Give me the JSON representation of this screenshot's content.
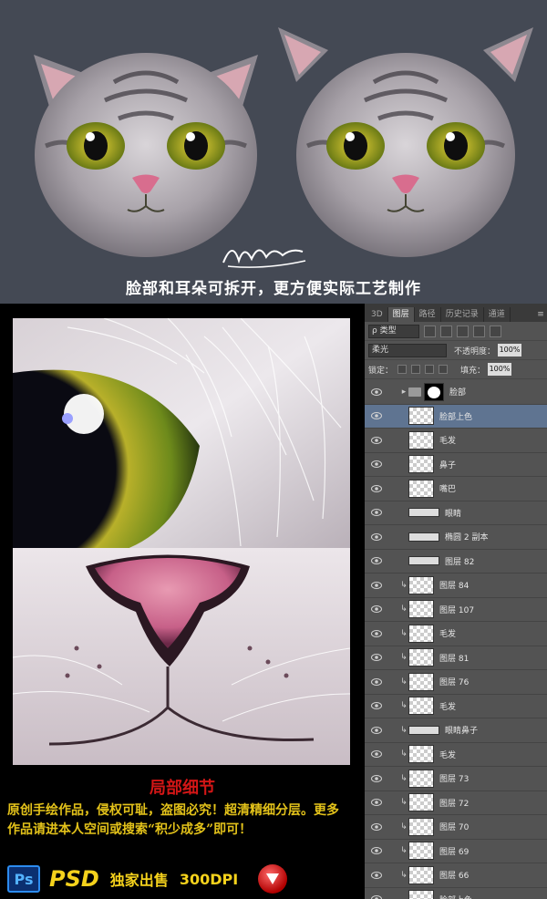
{
  "banner": {
    "headline": "脸部和耳朵可拆开，更方便实际工艺制作",
    "background_color": "#444954"
  },
  "details": {
    "title": "局部细节",
    "description": "原创手绘作品，侵权可耻，盗图必究！超清精细分层。更多作品请进本人空间或搜索“积少成多”即可！",
    "accent_color": "#e3c21a",
    "title_color": "#d31616"
  },
  "footer": {
    "ps_icon": "Ps",
    "format": "PSD",
    "exclusive": "独家出售",
    "dpi": "300DPI",
    "download_icon": "download-arrow-icon"
  },
  "panel": {
    "tabs": [
      {
        "label": "3D",
        "active": false
      },
      {
        "label": "图层",
        "active": true
      },
      {
        "label": "路径",
        "active": false
      },
      {
        "label": "历史记录",
        "active": false
      },
      {
        "label": "通道",
        "active": false
      }
    ],
    "filter_kind": "ρ 类型",
    "blend_mode": "柔光",
    "opacity_label": "不透明度：",
    "opacity_value": "100%",
    "lock_label": "锁定：",
    "fill_label": "填充：",
    "fill_value": "100%",
    "layers": [
      {
        "name": "脸部",
        "type": "group",
        "has_mask": true,
        "selected": false,
        "clipped": false
      },
      {
        "name": "脸部上色",
        "type": "layer",
        "selected": true,
        "clipped": false
      },
      {
        "name": "毛发",
        "type": "layer",
        "selected": false,
        "clipped": false
      },
      {
        "name": "鼻子",
        "type": "layer",
        "selected": false,
        "clipped": false
      },
      {
        "name": "嘴巴",
        "type": "layer",
        "selected": false,
        "clipped": false
      },
      {
        "name": "眼睛",
        "type": "wide",
        "selected": false,
        "clipped": false
      },
      {
        "name": "椭圆 2 副本",
        "type": "wide",
        "selected": false,
        "clipped": false
      },
      {
        "name": "图层 82",
        "type": "wide",
        "selected": false,
        "clipped": false
      },
      {
        "name": "图层 84",
        "type": "layer",
        "selected": false,
        "clipped": true
      },
      {
        "name": "图层 107",
        "type": "layer",
        "selected": false,
        "clipped": true
      },
      {
        "name": "毛发",
        "type": "layer",
        "selected": false,
        "clipped": true
      },
      {
        "name": "图层 81",
        "type": "layer",
        "selected": false,
        "clipped": true
      },
      {
        "name": "图层 76",
        "type": "layer",
        "selected": false,
        "clipped": true
      },
      {
        "name": "毛发",
        "type": "layer",
        "selected": false,
        "clipped": true
      },
      {
        "name": "眼睛鼻子",
        "type": "wide",
        "selected": false,
        "clipped": true
      },
      {
        "name": "毛发",
        "type": "layer",
        "selected": false,
        "clipped": true
      },
      {
        "name": "图层 73",
        "type": "layer",
        "selected": false,
        "clipped": true
      },
      {
        "name": "图层 72",
        "type": "layer",
        "selected": false,
        "clipped": true
      },
      {
        "name": "图层 70",
        "type": "layer",
        "selected": false,
        "clipped": true
      },
      {
        "name": "图层 69",
        "type": "layer",
        "selected": false,
        "clipped": true
      },
      {
        "name": "图层 66",
        "type": "layer",
        "selected": false,
        "clipped": true
      },
      {
        "name": "脸部上色",
        "type": "layer",
        "selected": false,
        "clipped": false
      }
    ]
  }
}
